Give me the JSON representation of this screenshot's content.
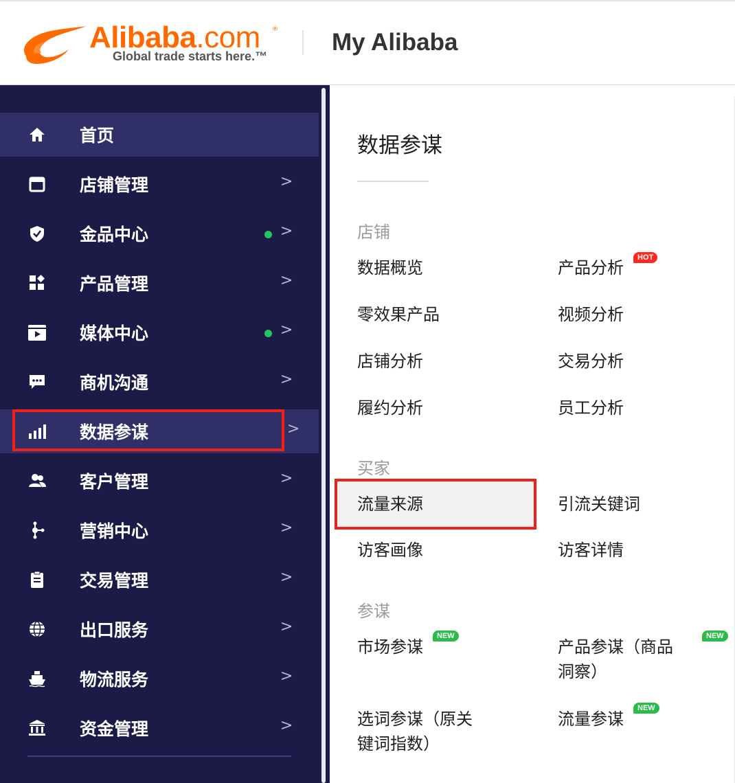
{
  "header": {
    "logo_word_main": "Alibaba",
    "logo_word_com": ".com",
    "logo_reg": "®",
    "logo_tagline": "Global trade starts here.™",
    "title": "My Alibaba"
  },
  "sidebar": {
    "items": [
      {
        "label": "首页",
        "icon": "home-icon",
        "active": true
      },
      {
        "label": "店铺管理",
        "icon": "store-icon",
        "arrow": ">"
      },
      {
        "label": "金品中心",
        "icon": "shield-icon",
        "arrow": ">",
        "dot": true
      },
      {
        "label": "产品管理",
        "icon": "grid-icon",
        "arrow": ">"
      },
      {
        "label": "媒体中心",
        "icon": "video-icon",
        "arrow": ">",
        "dot": true
      },
      {
        "label": "商机沟通",
        "icon": "chat-icon",
        "arrow": ">"
      },
      {
        "label": "数据参谋",
        "icon": "bar-chart-icon",
        "arrow": ">",
        "selected": true
      },
      {
        "label": "客户管理",
        "icon": "users-icon",
        "arrow": ">"
      },
      {
        "label": "营销中心",
        "icon": "network-icon",
        "arrow": ">"
      },
      {
        "label": "交易管理",
        "icon": "clipboard-icon",
        "arrow": ">"
      },
      {
        "label": "出口服务",
        "icon": "globe-icon",
        "arrow": ">"
      },
      {
        "label": "物流服务",
        "icon": "ship-icon",
        "arrow": ">"
      },
      {
        "label": "资金管理",
        "icon": "bank-icon",
        "arrow": ">"
      }
    ],
    "dot_color": "#22c55e",
    "bg_color": "#1c1b47",
    "active_color": "#302f68"
  },
  "panel": {
    "title": "数据参谋",
    "sections": [
      {
        "title": "店铺",
        "items": [
          "数据概览",
          "产品分析",
          "零效果产品",
          "视频分析",
          "店铺分析",
          "交易分析",
          "履约分析",
          "员工分析"
        ]
      },
      {
        "title": "买家",
        "items": [
          "流量来源",
          "引流关键词",
          "访客画像",
          "访客详情"
        ]
      },
      {
        "title": "参谋",
        "items": [
          "市场参谋",
          "产品参谋（商品",
          "洞察）",
          "选词参谋（原关",
          "键词指数）",
          "流量参谋"
        ]
      }
    ],
    "badges": {
      "hot": "HOT",
      "new": "NEW"
    },
    "highlight_color": "#f0211b"
  }
}
